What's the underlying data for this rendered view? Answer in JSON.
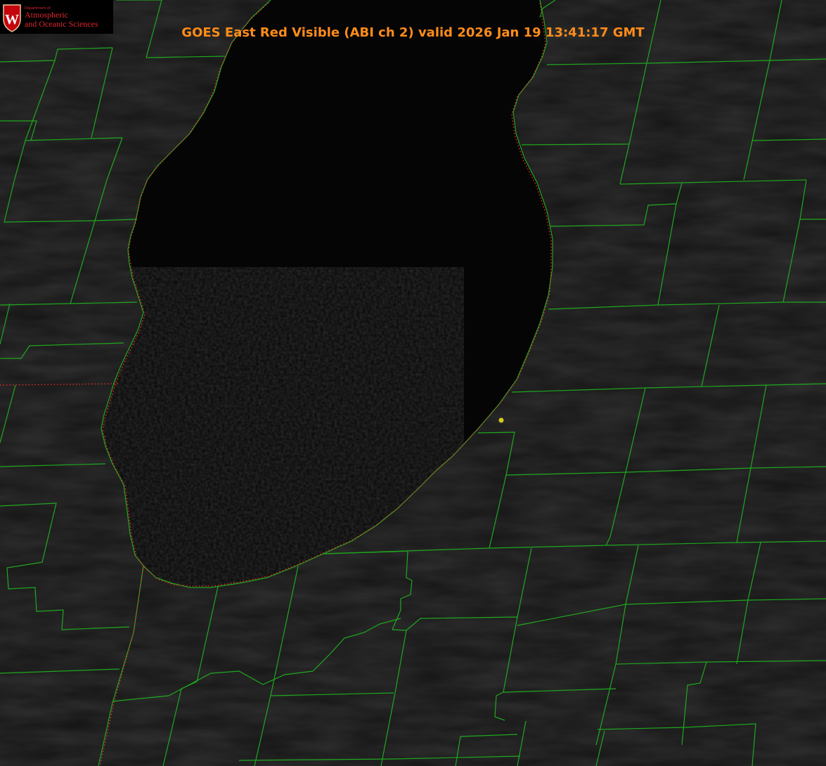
{
  "title": "GOES East Red Visible (ABI ch 2) valid 2026 Jan 19 13:41:17 GMT",
  "logo": {
    "small_text": "Department of",
    "line1": "Atmospheric",
    "line2": "and Oceanic Sciences",
    "crest_letter": "W",
    "crest_color": "#c5050c"
  },
  "colors": {
    "background": "#000000",
    "lake": "#050505",
    "land": "#141414",
    "county_lines": "#1fa81f",
    "state_lines": "#ff2a2a",
    "title": "#ff8c1a",
    "marker": "#d4cc1e"
  },
  "markers": [
    {
      "name": "station-marker",
      "color": "#d4cc1e"
    }
  ]
}
